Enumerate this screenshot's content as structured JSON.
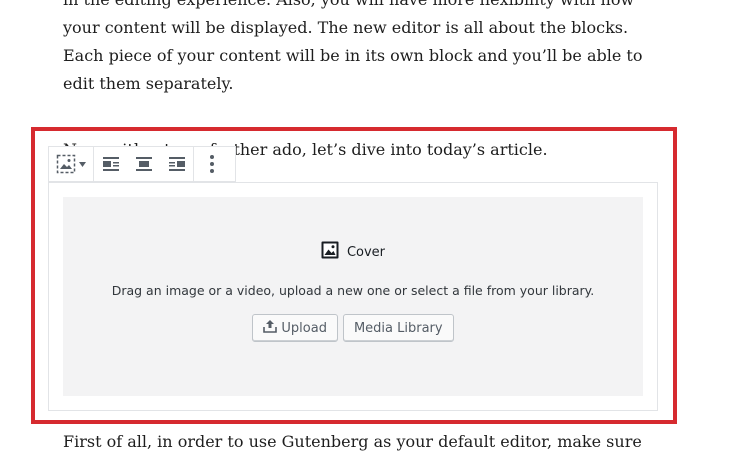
{
  "content": {
    "intro_text": "in the editing experience. Also, you will have more flexibility with how your content will be displayed. The new editor is all about the blocks. Each piece of your content will be in its own block and you’ll be able to edit them separately.",
    "lead_text": "Now, without any further ado, let’s dive into today’s article.",
    "after_text": "First of all, in order to use Gutenberg as your default editor, make sure"
  },
  "toolbar": {
    "icons": [
      "cover-block-icon",
      "chevron-down-icon",
      "align-left-icon",
      "align-center-icon",
      "align-right-icon",
      "more-options-icon"
    ]
  },
  "cover_block": {
    "title": "Cover",
    "instructions": "Drag an image or a video, upload a new one or select a file from your library.",
    "upload_label": "Upload",
    "media_library_label": "Media Library"
  },
  "colors": {
    "highlight_border": "#d62a2f",
    "placeholder_bg": "#f3f3f4"
  }
}
